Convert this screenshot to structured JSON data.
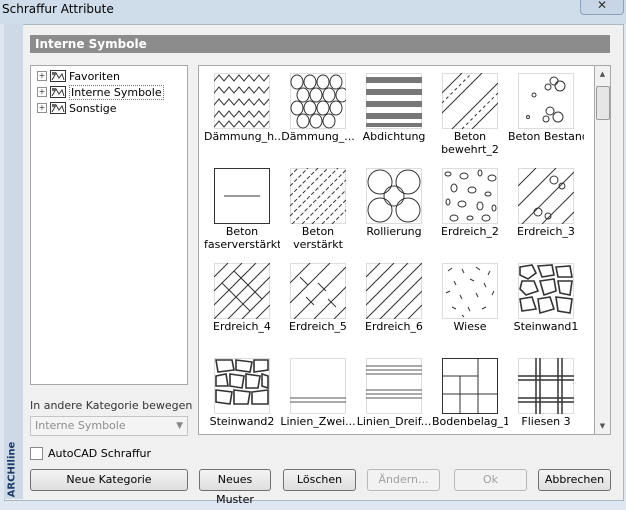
{
  "window": {
    "title": "Schraffur Attribute",
    "close_glyph": "✕",
    "brand": "ARCHIline"
  },
  "section": {
    "title": "Interne Symbole"
  },
  "tree": {
    "items": [
      {
        "label": "Favoriten",
        "expander": "+",
        "selected": false
      },
      {
        "label": "Interne Symbole",
        "expander": "+",
        "selected": true
      },
      {
        "label": "Sonstige",
        "expander": "+",
        "selected": false
      }
    ]
  },
  "move": {
    "label": "In andere Kategorie bewegen",
    "combo_value": "Interne Symbole"
  },
  "patterns": [
    {
      "label": "Dämmung_h...",
      "pattern": "zigzag"
    },
    {
      "label": "Dämmung_...",
      "pattern": "scallops"
    },
    {
      "label": "Abdichtung",
      "pattern": "thick-stripes"
    },
    {
      "label": "Beton bewehrt_2",
      "pattern": "diag-dashed"
    },
    {
      "label": "Beton Bestand",
      "pattern": "bubbles"
    },
    {
      "label": "Beton faserverstärkt",
      "pattern": "box-line"
    },
    {
      "label": "Beton verstärkt",
      "pattern": "dense-diag"
    },
    {
      "label": "Rollierung",
      "pattern": "circles"
    },
    {
      "label": "Erdreich_2",
      "pattern": "pebbles"
    },
    {
      "label": "Erdreich_3",
      "pattern": "diag-circles"
    },
    {
      "label": "Erdreich_4",
      "pattern": "crosshatch"
    },
    {
      "label": "Erdreich_5",
      "pattern": "diag-ticks"
    },
    {
      "label": "Erdreich_6",
      "pattern": "diag-sparse"
    },
    {
      "label": "Wiese",
      "pattern": "grass"
    },
    {
      "label": "Steinwand1",
      "pattern": "stone"
    },
    {
      "label": "Steinwand2",
      "pattern": "stone2"
    },
    {
      "label": "Linien_Zwei...",
      "pattern": "two-lines"
    },
    {
      "label": "Linien_Dreif...",
      "pattern": "three-lines"
    },
    {
      "label": "Bodenbelag_1",
      "pattern": "parquet"
    },
    {
      "label": "Fliesen 3",
      "pattern": "tiles"
    }
  ],
  "checkbox": {
    "label": "AutoCAD Schraffur",
    "checked": false
  },
  "buttons": {
    "neue_kategorie": "Neue Kategorie",
    "neues_muster": "Neues Muster",
    "loeschen": "Löschen",
    "aendern": "Ändern...",
    "ok": "Ok",
    "abbrechen": "Abbrechen"
  }
}
